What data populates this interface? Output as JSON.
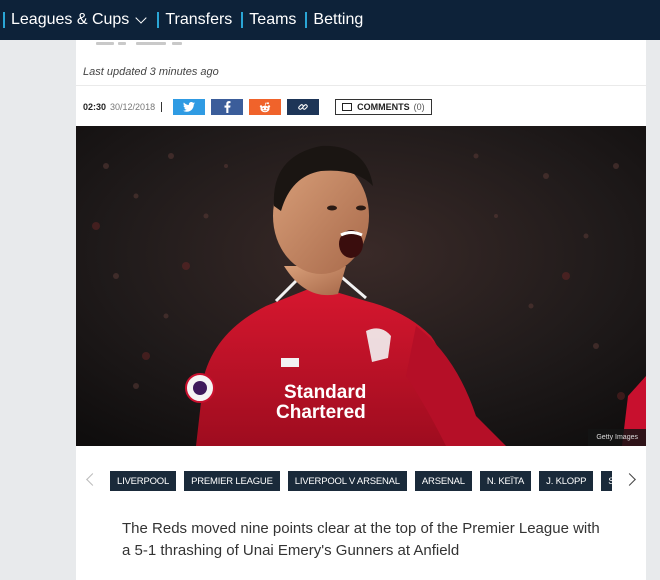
{
  "nav": {
    "items": [
      {
        "label": "Leagues & Cups",
        "has_dropdown": true
      },
      {
        "label": "Transfers"
      },
      {
        "label": "Teams"
      },
      {
        "label": "Betting"
      }
    ]
  },
  "article": {
    "last_updated": "Last updated 3 minutes ago",
    "time": "02:30",
    "date": "30/12/2018",
    "share": [
      {
        "network": "twitter",
        "icon": "twitter-icon",
        "color": "#2f9be3"
      },
      {
        "network": "facebook",
        "icon": "facebook-icon",
        "color": "#3b5d9a"
      },
      {
        "network": "reddit",
        "icon": "reddit-icon",
        "color": "#f0632b"
      },
      {
        "network": "link",
        "icon": "link-icon",
        "color": "#1d3557"
      }
    ],
    "comments_label": "COMMENTS",
    "comments_count": "(0)",
    "image_credit": "Getty Images",
    "sponsor_line1": "Standard",
    "sponsor_line2": "Chartered",
    "tags": [
      "LIVERPOOL",
      "PREMIER LEAGUE",
      "LIVERPOOL V ARSENAL",
      "ARSENAL",
      "N. KEÏTA",
      "J. KLOPP",
      "S. MANÉ"
    ],
    "lede": "The Reds moved nine points clear at the top of the Premier League with a 5-1 thrashing of Unai Emery's Gunners at Anfield"
  },
  "colors": {
    "nav_bg": "#0d2239",
    "nav_separator": "#2aa6d6",
    "tag_bg": "#1a2a3a",
    "kit_red": "#c8102e"
  }
}
